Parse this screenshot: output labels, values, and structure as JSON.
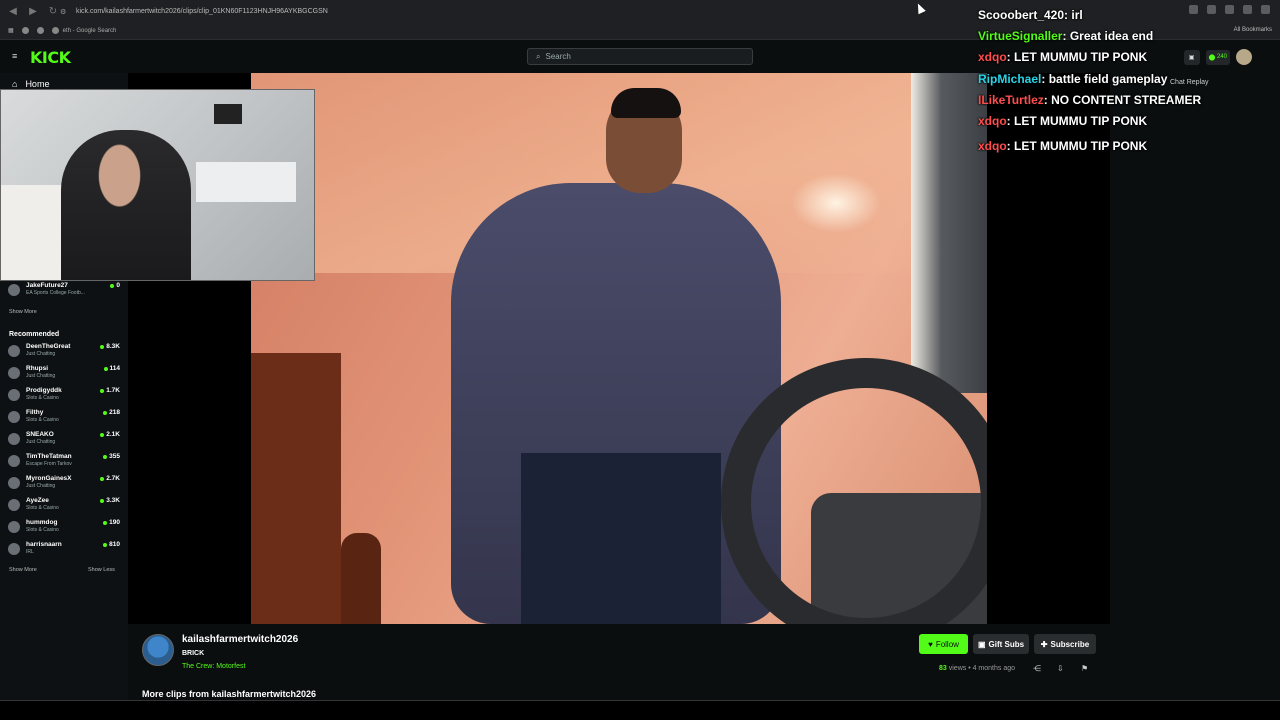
{
  "browser": {
    "url": "kick.com/kailashfarmertwitch2026/clips/clip_01KN60F1123HNJH96AYKBGCGSN",
    "bookmark": "eth - Google Search",
    "all_bookmarks": "All Bookmarks"
  },
  "header": {
    "logo": "KICK",
    "search_placeholder": "Search",
    "kicks_count": "240"
  },
  "sidebar": {
    "home": "Home",
    "following_item": {
      "name": "JakeFuture27",
      "category": "EA Sports College Footb...",
      "viewers": "0"
    },
    "show_more": "Show More",
    "recommended_title": "Recommended",
    "recommended": [
      {
        "name": "DeenTheGreat",
        "category": "Just Chatting",
        "viewers": "8.3K"
      },
      {
        "name": "Rhupsi",
        "category": "Just Chatting",
        "viewers": "114"
      },
      {
        "name": "Prodigyddk",
        "category": "Slots & Casino",
        "viewers": "1.7K"
      },
      {
        "name": "Filthy",
        "category": "Slots & Casino",
        "viewers": "218"
      },
      {
        "name": "SNEAKO",
        "category": "Just Chatting",
        "viewers": "2.1K"
      },
      {
        "name": "TimTheTatman",
        "category": "Escape From Tarkov",
        "viewers": "355"
      },
      {
        "name": "MyronGainesX",
        "category": "Just Chatting",
        "viewers": "2.7K"
      },
      {
        "name": "AyeZee",
        "category": "Slots & Casino",
        "viewers": "3.3K"
      },
      {
        "name": "hummdog",
        "category": "Slots & Casino",
        "viewers": "190"
      },
      {
        "name": "harrisnaarn",
        "category": "IRL",
        "viewers": "810"
      }
    ],
    "show_more_2": "Show More",
    "show_less": "Show Less"
  },
  "chat": {
    "replay_label": "Chat Replay",
    "messages": [
      {
        "user": "Scooobert_420",
        "text": "irl",
        "color": "#ffffff"
      },
      {
        "user": "VirtueSignaller",
        "text": "Great idea end",
        "color": "#53fc18"
      },
      {
        "user": "xdqo",
        "text": "LET MUMMU TIP PONK",
        "color": "#ff4d4d"
      },
      {
        "user": "RipMichael",
        "text": "battle field gameplay",
        "color": "#28d4e8"
      },
      {
        "user": "ILikeTurtlez",
        "text": "NO CONTENT STREAMER",
        "color": "#ff4d4d"
      },
      {
        "user": "xdqo",
        "text": "LET MUMMU TIP PONK",
        "color": "#ff4d4d"
      },
      {
        "user": "xdqo",
        "text": "LET MUMMU TIP PONK",
        "color": "#ff4d4d"
      }
    ]
  },
  "clip": {
    "channel": "kailashfarmertwitch2026",
    "title": "BRICK",
    "category": "The Crew: Motorfest",
    "views": "83",
    "views_label": " views",
    "age": " • 4 months ago",
    "more_clips": "More clips from kailashfarmertwitch2026"
  },
  "buttons": {
    "follow": "Follow",
    "gift_subs": "Gift Subs",
    "subscribe": "Subscribe"
  }
}
